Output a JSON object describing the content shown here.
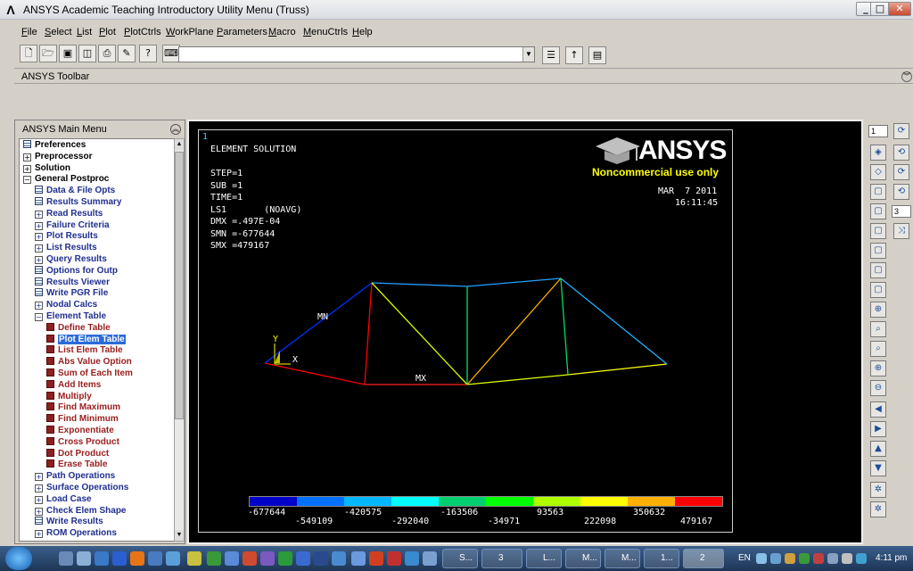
{
  "window": {
    "title": "ANSYS Academic Teaching Introductory Utility Menu (Truss)",
    "icon": "ansys-logo-icon",
    "controls": {
      "minimize": "_",
      "maximize": "□",
      "close": "✕"
    }
  },
  "menubar": [
    "File",
    "Select",
    "List",
    "Plot",
    "PlotCtrls",
    "WorkPlane",
    "Parameters",
    "Macro",
    "MenuCtrls",
    "Help"
  ],
  "command_input": {
    "value": ""
  },
  "toolbar": {
    "label": "ANSYS Toolbar"
  },
  "main_menu": {
    "title": "ANSYS Main Menu",
    "items": [
      {
        "label": "Preferences",
        "level": 0,
        "icon": "doc"
      },
      {
        "label": "Preprocessor",
        "level": 0,
        "icon": "plus"
      },
      {
        "label": "Solution",
        "level": 0,
        "icon": "plus"
      },
      {
        "label": "General Postproc",
        "level": 0,
        "icon": "minus"
      },
      {
        "label": "Data & File Opts",
        "level": 1,
        "icon": "doc"
      },
      {
        "label": "Results Summary",
        "level": 1,
        "icon": "doc"
      },
      {
        "label": "Read Results",
        "level": 1,
        "icon": "plus"
      },
      {
        "label": "Failure Criteria",
        "level": 1,
        "icon": "plus"
      },
      {
        "label": "Plot Results",
        "level": 1,
        "icon": "plus"
      },
      {
        "label": "List Results",
        "level": 1,
        "icon": "plus"
      },
      {
        "label": "Query Results",
        "level": 1,
        "icon": "plus"
      },
      {
        "label": "Options for Outp",
        "level": 1,
        "icon": "doc"
      },
      {
        "label": "Results Viewer",
        "level": 1,
        "icon": "doc"
      },
      {
        "label": "Write PGR File",
        "level": 1,
        "icon": "doc"
      },
      {
        "label": "Nodal Calcs",
        "level": 1,
        "icon": "plus"
      },
      {
        "label": "Element Table",
        "level": 1,
        "icon": "minus"
      },
      {
        "label": "Define Table",
        "level": 2,
        "icon": "red"
      },
      {
        "label": "Plot Elem Table",
        "level": 2,
        "icon": "red",
        "selected": true
      },
      {
        "label": "List Elem Table",
        "level": 2,
        "icon": "red"
      },
      {
        "label": "Abs Value Option",
        "level": 2,
        "icon": "red"
      },
      {
        "label": "Sum of Each Item",
        "level": 2,
        "icon": "red"
      },
      {
        "label": "Add Items",
        "level": 2,
        "icon": "red"
      },
      {
        "label": "Multiply",
        "level": 2,
        "icon": "red"
      },
      {
        "label": "Find Maximum",
        "level": 2,
        "icon": "red"
      },
      {
        "label": "Find Minimum",
        "level": 2,
        "icon": "red"
      },
      {
        "label": "Exponentiate",
        "level": 2,
        "icon": "red"
      },
      {
        "label": "Cross Product",
        "level": 2,
        "icon": "red"
      },
      {
        "label": "Dot Product",
        "level": 2,
        "icon": "red"
      },
      {
        "label": "Erase Table",
        "level": 2,
        "icon": "red"
      },
      {
        "label": "Path Operations",
        "level": 1,
        "icon": "plus"
      },
      {
        "label": "Surface Operations",
        "level": 1,
        "icon": "plus"
      },
      {
        "label": "Load Case",
        "level": 1,
        "icon": "plus"
      },
      {
        "label": "Check Elem Shape",
        "level": 1,
        "icon": "plus"
      },
      {
        "label": "Write Results",
        "level": 1,
        "icon": "doc"
      },
      {
        "label": "ROM Operations",
        "level": 1,
        "icon": "plus"
      }
    ]
  },
  "graphics": {
    "window_number": "1",
    "header": [
      "ELEMENT SOLUTION",
      "",
      "STEP=1",
      "SUB =1",
      "TIME=1",
      "LS1       (NOAVG)",
      "DMX =.497E-04",
      "SMN =-677644",
      "SMX =479167"
    ],
    "date": "MAR  7 2011",
    "time": "16:11:45",
    "logo": "ANSYS",
    "logo_note": "Noncommercial use only",
    "label_mn": "MN",
    "label_mx": "MX",
    "axis_y": "Y",
    "axis_x": "X",
    "legend": {
      "colors": [
        "#0000c8",
        "#0070ff",
        "#00b8ff",
        "#00ffff",
        "#00d070",
        "#00ff00",
        "#b0ff00",
        "#ffff00",
        "#ffb000",
        "#ff0000"
      ],
      "top_values": [
        "-677644",
        "-420575",
        "-163506",
        "93563",
        "350632"
      ],
      "bottom_values": [
        "-549109",
        "-292040",
        "-34971",
        "222098",
        "479167"
      ]
    }
  },
  "right_toolbar": {
    "window_select": "1",
    "view_select": "3"
  },
  "taskbar": {
    "tasks": [
      "S...",
      "3",
      "L...",
      "M...",
      "M...",
      "1...",
      "2"
    ],
    "language": "EN",
    "clock": "4:11 pm"
  }
}
